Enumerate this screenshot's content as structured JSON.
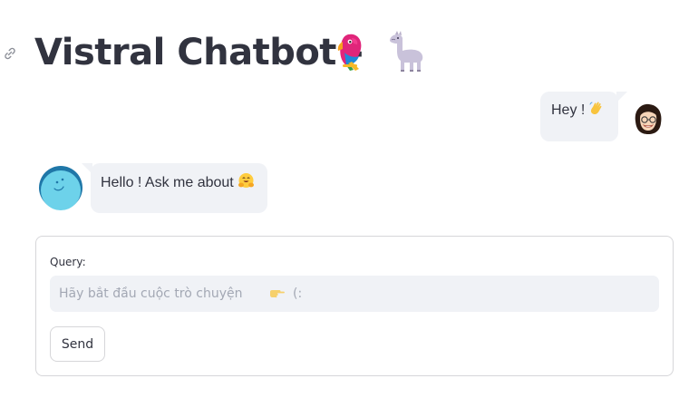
{
  "header": {
    "title": "Vistral Chatbot -",
    "emojis": [
      "parrot-icon",
      "llama-icon"
    ]
  },
  "messages": [
    {
      "role": "user",
      "text": "Hey !",
      "emoji": "waving-hand-icon"
    },
    {
      "role": "assistant",
      "text": "Hello ! Ask me about",
      "emoji": "hugging-face-icon"
    }
  ],
  "form": {
    "label": "Query:",
    "placeholder": "Hãy bắt đầu cuộc trò chuyện",
    "placeholder_emoji": "pointing-right-icon",
    "placeholder_tail": "(:",
    "button_label": "Send"
  },
  "colors": {
    "text": "#31333f",
    "bubble": "#f0f2f6",
    "border": "#d6d6d9",
    "placeholder": "#a3a8b4"
  }
}
